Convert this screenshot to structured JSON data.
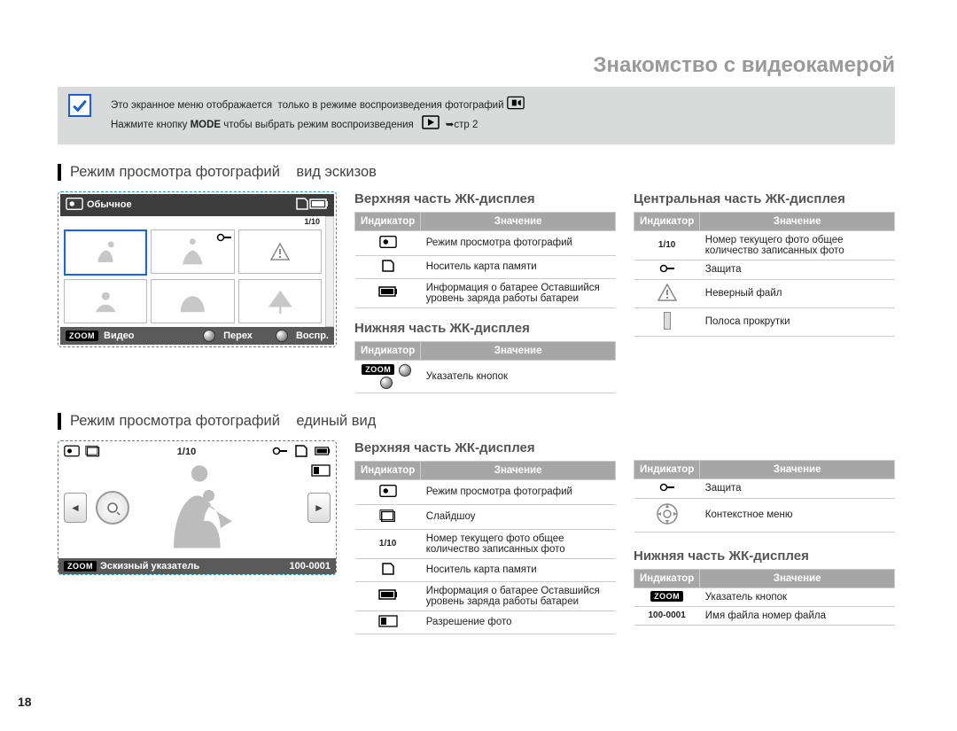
{
  "page_number": "18",
  "chapter_title": "Знакомство с видеокамерой",
  "note": {
    "line1a": "Это экранное меню отображается",
    "line1b": "только в режиме воспроизведения фотографий",
    "line2a": "Нажмите кнопку",
    "mode_label": "MODE",
    "line2b": "чтобы выбрать режим воспроизведения",
    "page_ref": "стр 2"
  },
  "section1": {
    "title_a": "Режим просмотра фотографий",
    "title_b": "вид эскизов",
    "screen": {
      "top_label": "Обычное",
      "count": "1/10",
      "bottom_zoom": "ZOOM",
      "bottom_video": "Видео",
      "bottom_move": "Перех",
      "bottom_play": "Воспр."
    },
    "top_table": {
      "title": "Верхняя часть ЖК-дисплея",
      "h_ind": "Индикатор",
      "h_val": "Значение",
      "rows": [
        {
          "val": "Режим просмотра фотографий"
        },
        {
          "val": "Носитель карта памяти"
        },
        {
          "val": "Информация о батарее Оставшийся уровень заряда работы батареи"
        }
      ]
    },
    "bottom_table": {
      "title": "Нижняя часть ЖК-дисплея",
      "h_ind": "Индикатор",
      "h_val": "Значение",
      "rows": [
        {
          "val": "Указатель кнопок"
        }
      ]
    },
    "center_table": {
      "title": "Центральная часть ЖК-дисплея",
      "h_ind": "Индикатор",
      "h_val": "Значение",
      "rows": [
        {
          "ic": "1/10",
          "val": "Номер текущего фото общее количество записанных фото"
        },
        {
          "ic": "",
          "val": "Защита"
        },
        {
          "ic": "",
          "val": "Неверный файл"
        },
        {
          "ic": "",
          "val": "Полоса прокрутки"
        }
      ]
    }
  },
  "section2": {
    "title_a": "Режим просмотра фотографий",
    "title_b": "единый вид",
    "screen": {
      "count": "1/10",
      "bottom_zoom": "ZOOM",
      "bottom_label": "Эскизный указатель",
      "file_no": "100-0001"
    },
    "top_left": {
      "title": "Верхняя часть ЖК-дисплея",
      "h_ind": "Индикатор",
      "h_val": "Значение",
      "rows": [
        {
          "val": "Режим просмотра фотографий"
        },
        {
          "val": "Слайдшоу"
        },
        {
          "ic": "1/10",
          "val": "Номер текущего фото общее количество записанных фото"
        },
        {
          "val": "Носитель карта памяти"
        },
        {
          "val": "Информация о батарее Оставшийся уровень заряда работы батареи"
        },
        {
          "val": "Разрешение фото"
        }
      ]
    },
    "top_right": {
      "h_ind": "Индикатор",
      "h_val": "Значение",
      "rows": [
        {
          "val": "Защита"
        },
        {
          "val": "Контекстное меню"
        }
      ]
    },
    "bottom_right": {
      "title": "Нижняя часть ЖК-дисплея",
      "h_ind": "Индикатор",
      "h_val": "Значение",
      "rows": [
        {
          "val": "Указатель кнопок"
        },
        {
          "ic": "100-0001",
          "val": "Имя файла номер файла"
        }
      ]
    }
  }
}
